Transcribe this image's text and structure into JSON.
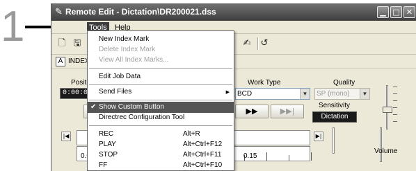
{
  "callout": {
    "step_number": "1"
  },
  "window": {
    "title": "Remote Edit - Dictation\\DR200021.dss",
    "title_icon": "pen-icon",
    "controls": {
      "minimize": "▁",
      "maximize": "□",
      "close": "✕"
    }
  },
  "menubar": {
    "items": [
      {
        "label": "Tools",
        "active": true
      },
      {
        "label": "Help",
        "active": false
      }
    ]
  },
  "toolbar": {
    "icons": [
      "new-file-icon",
      "save-icon",
      "edit-pen-icon",
      "undo-icon"
    ]
  },
  "index_bar": {
    "icon_label": "A",
    "label": "INDEX"
  },
  "main": {
    "position_label": "Positio",
    "position_value": "0:00:0",
    "work_type_label": "Work Type",
    "work_type_value": "BCD",
    "quality_label": "Quality",
    "quality_value": "SP (mono)",
    "sensitivity_label": "Sensitivity",
    "sensitivity_value": "Dictation",
    "timeline_start": "0.0",
    "timeline_mark": "0.15",
    "volume_label": "Volume",
    "transport": {
      "play": "▶▶",
      "fast_forward": "▶▶|"
    }
  },
  "tools_menu": {
    "items": [
      {
        "label": "New Index Mark",
        "disabled": false
      },
      {
        "label": "Delete Index Mark",
        "disabled": true
      },
      {
        "label": "View All Index Marks...",
        "disabled": true
      },
      {
        "label": "Edit Job Data",
        "disabled": false
      },
      {
        "label": "Send Files",
        "disabled": false,
        "submenu": "▶"
      },
      {
        "label": "Show Custom Button",
        "checked": true,
        "check": "✔"
      },
      {
        "label": "Directrec Configuration Tool",
        "disabled": false
      },
      {
        "label": "REC",
        "shortcut": "Alt+R"
      },
      {
        "label": "PLAY",
        "shortcut": "Alt+Ctrl+F12"
      },
      {
        "label": "STOP",
        "shortcut": "Alt+Ctrl+F11"
      },
      {
        "label": "FF",
        "shortcut": "Alt+Ctrl+F10"
      }
    ]
  }
}
